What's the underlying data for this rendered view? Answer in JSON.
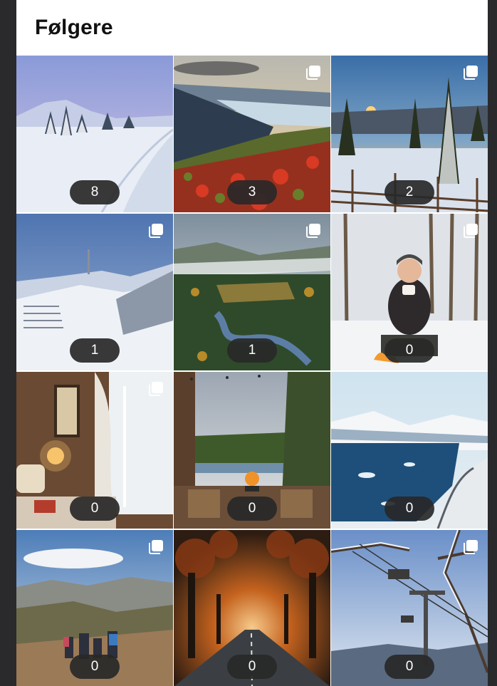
{
  "header": {
    "title": "Følgere"
  },
  "posts": [
    {
      "count": "8",
      "carousel": false,
      "scene": "ski-trail-snow"
    },
    {
      "count": "3",
      "carousel": true,
      "scene": "fjord-autumn-heather"
    },
    {
      "count": "2",
      "carousel": true,
      "scene": "sunset-snowy-forest"
    },
    {
      "count": "1",
      "carousel": true,
      "scene": "mountain-summit-snow"
    },
    {
      "count": "1",
      "carousel": true,
      "scene": "valley-river-forest"
    },
    {
      "count": "0",
      "carousel": true,
      "scene": "woman-campfire-snow"
    },
    {
      "count": "0",
      "carousel": true,
      "scene": "cozy-cabin-window"
    },
    {
      "count": "0",
      "carousel": false,
      "scene": "cabin-terrace-firepit"
    },
    {
      "count": "0",
      "carousel": false,
      "scene": "glacier-lake-road"
    },
    {
      "count": "0",
      "carousel": true,
      "scene": "hikers-mountain-plateau"
    },
    {
      "count": "0",
      "carousel": false,
      "scene": "autumn-tree-tunnel-road"
    },
    {
      "count": "0",
      "carousel": true,
      "scene": "ski-chairlift-frost"
    }
  ],
  "icons": {
    "carousel": "multiple-images-icon"
  },
  "colors": {
    "background": "#2a2a2c",
    "panel": "#ffffff",
    "badge": "#282828",
    "badge_text": "#ffffff"
  }
}
